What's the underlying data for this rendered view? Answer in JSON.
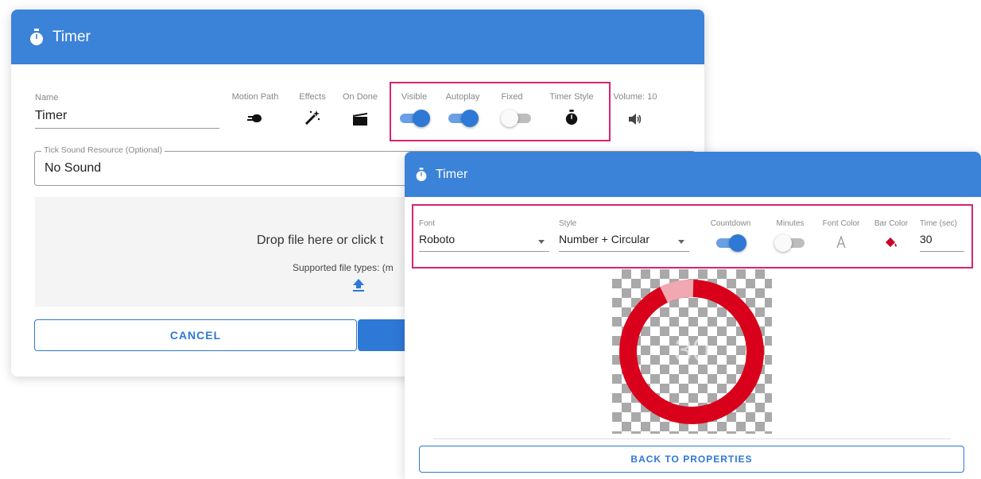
{
  "dialog1": {
    "title": "Timer",
    "name_label": "Name",
    "name_value": "Timer",
    "props": {
      "motion_path": "Motion Path",
      "effects": "Effects",
      "on_done": "On Done",
      "visible": "Visible",
      "autoplay": "Autoplay",
      "fixed": "Fixed",
      "timer_style": "Timer Style",
      "volume": "Volume: 10"
    },
    "toggles": {
      "visible": true,
      "autoplay": true,
      "fixed": false
    },
    "tick_sound_label": "Tick Sound Resource (Optional)",
    "tick_sound_value": "No Sound",
    "drop_text": "Drop file here or click t",
    "supported_text": "Supported file types: (m",
    "cancel_label": "CANCEL"
  },
  "dialog2": {
    "title": "Timer",
    "font_label": "Font",
    "font_value": "Roboto",
    "style_label": "Style",
    "style_value": "Number + Circular",
    "countdown_label": "Countdown",
    "minutes_label": "Minutes",
    "font_color_label": "Font Color",
    "bar_color_label": "Bar Color",
    "time_label": "Time (sec)",
    "time_value": "30",
    "toggles": {
      "countdown": true,
      "minutes": false
    },
    "preview_number": "30",
    "back_label": "BACK TO PROPERTIES",
    "bar_color": "#d9001b",
    "font_color": "#ffffff"
  },
  "colors": {
    "header": "#3b82d9",
    "accent": "#2e78d6",
    "highlight": "#d6246e"
  },
  "icons": {
    "header_timer": "stopwatch-icon",
    "motion_path": "motion-path-icon",
    "effects": "magic-wand-icon",
    "on_done": "clapperboard-icon",
    "timer_style": "stopwatch-icon",
    "volume": "speaker-icon",
    "upload": "upload-icon",
    "font_color": "text-color-icon",
    "bar_color": "paint-bucket-icon"
  }
}
